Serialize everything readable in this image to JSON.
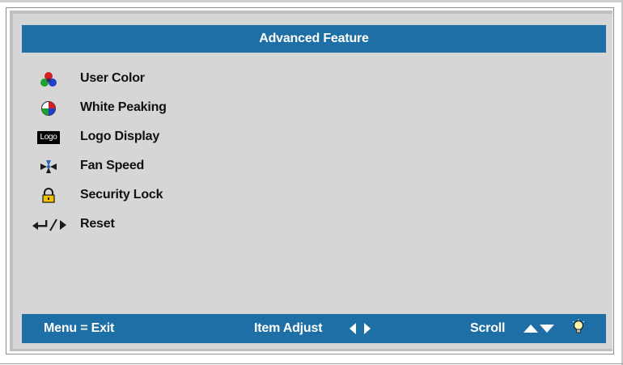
{
  "title": "Advanced Feature",
  "menu": {
    "items": [
      {
        "label": "User Color",
        "icon": "user-color-icon"
      },
      {
        "label": "White Peaking",
        "icon": "white-peaking-icon"
      },
      {
        "label": "Logo Display",
        "icon": "logo-display-icon",
        "icon_text": "Logo"
      },
      {
        "label": "Fan Speed",
        "icon": "fan-speed-icon"
      },
      {
        "label": "Security Lock",
        "icon": "security-lock-icon"
      },
      {
        "label": "Reset",
        "icon": "enter-left-right-icon"
      }
    ]
  },
  "footer": {
    "exit_label": "Menu = Exit",
    "adjust_label": "Item Adjust",
    "scroll_label": "Scroll"
  },
  "colors": {
    "bar": "#1d6fa5",
    "panel": "#d6d6d6",
    "text": "#111111"
  }
}
